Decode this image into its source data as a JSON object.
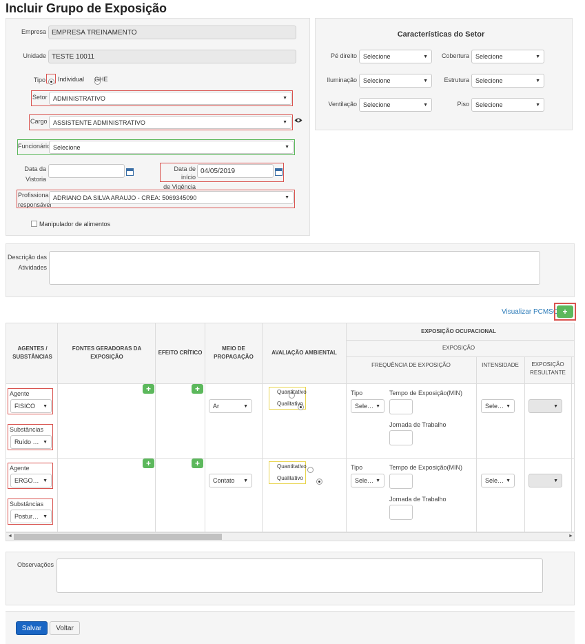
{
  "page": {
    "title": "Incluir Grupo de Exposição"
  },
  "form": {
    "empresa": {
      "label": "Empresa",
      "value": "EMPRESA TREINAMENTO"
    },
    "unidade": {
      "label": "Unidade",
      "value": "TESTE 10011"
    },
    "tipo": {
      "label": "Tipo",
      "options": [
        "Individual",
        "GHE"
      ],
      "selected": "Individual"
    },
    "setor": {
      "label": "Setor",
      "value": "ADMINISTRATIVO"
    },
    "cargo": {
      "label": "Cargo",
      "value": "ASSISTENTE ADMINISTRATIVO"
    },
    "funcionario": {
      "label": "Funcionário",
      "value": "Selecione"
    },
    "data_vistoria": {
      "label_1": "Data da",
      "label_2": "Vistoria",
      "value": ""
    },
    "data_inicio": {
      "label_1": "Data de início",
      "label_2": "de Vigência",
      "value": "04/05/2019"
    },
    "profissional": {
      "label_1": "Profissional",
      "label_2": "responsável",
      "value": "ADRIANO DA SILVA ARAUJO - CREA: 5069345090"
    },
    "manipulador": {
      "label": "Manipulador de alimentos",
      "checked": false
    },
    "descricao": {
      "label_1": "Descrição das",
      "label_2": "Atividades",
      "value": ""
    },
    "observacoes": {
      "label": "Observações",
      "value": ""
    }
  },
  "caracteristicas": {
    "title": "Características do Setor",
    "fields": [
      {
        "label": "Pé direito",
        "value": "Selecione"
      },
      {
        "label": "Cobertura",
        "value": "Selecione"
      },
      {
        "label": "Iluminação",
        "value": "Selecione"
      },
      {
        "label": "Estrutura",
        "value": "Selecione"
      },
      {
        "label": "Ventilação",
        "value": "Selecione"
      },
      {
        "label": "Piso",
        "value": "Selecione"
      }
    ]
  },
  "pcmso": {
    "link_label": "Visualizar PCMSO",
    "add_symbol": "+"
  },
  "table": {
    "headers": {
      "agentes": "AGENTES / SUBSTÂNCIAS",
      "fontes": "FONTES GERADORAS DA EXPOSIÇÃO",
      "efeito": "EFEITO CRÍTICO",
      "meio": "MEIO DE PROPAGAÇÃO",
      "avaliacao": "AVALIAÇÃO AMBIENTAL",
      "exposicao_ocupacional": "EXPOSIÇÃO OCUPACIONAL",
      "exposicao": "EXPOSIÇÃO",
      "frequencia": "FREQUÊNCIA DE EXPOSIÇÃO",
      "intensidade": "INTENSIDADE",
      "resultante": "EXPOSIÇÃO RESULTANTE"
    },
    "rows": [
      {
        "agente_label": "Agente",
        "agente_value": "FISICO",
        "substancias_label": "Substâncias",
        "substancias_value": "Ruído co...",
        "meio_value": "Ar",
        "quantitativo": "Quantitativo",
        "qualitativo": "Qualitativo",
        "avaliacao_selected": "Qualitativo",
        "tipo_label": "Tipo",
        "tipo_value": "Selecior",
        "tempo_label": "Tempo de Exposição(MIN)",
        "jornada_label": "Jornada de Trabalho",
        "intensidade_value": "Selecior",
        "resultante_value": ""
      },
      {
        "agente_label": "Agente",
        "agente_value": "ERGONÔM",
        "substancias_label": "Substâncias",
        "substancias_value": "Postura s...",
        "meio_value": "Contato",
        "quantitativo": "Quantitativo",
        "qualitativo": "Qualitativo",
        "avaliacao_selected": "Qualitativo",
        "tipo_label": "Tipo",
        "tipo_value": "Selecior",
        "tempo_label": "Tempo de Exposição(MIN)",
        "jornada_label": "Jornada de Trabalho",
        "intensidade_value": "Selecior",
        "resultante_value": ""
      }
    ]
  },
  "icons": {
    "caret": "▼",
    "plus": "+",
    "scroll_left": "◄",
    "scroll_right": "►"
  },
  "actions": {
    "save": "Salvar",
    "back": "Voltar"
  },
  "colors": {
    "accent_blue": "#1a66c4",
    "green": "#5cb85c",
    "required_red": "#d9534f",
    "valid_green": "#5cb85c",
    "highlight_yellow": "#e8d44d"
  }
}
